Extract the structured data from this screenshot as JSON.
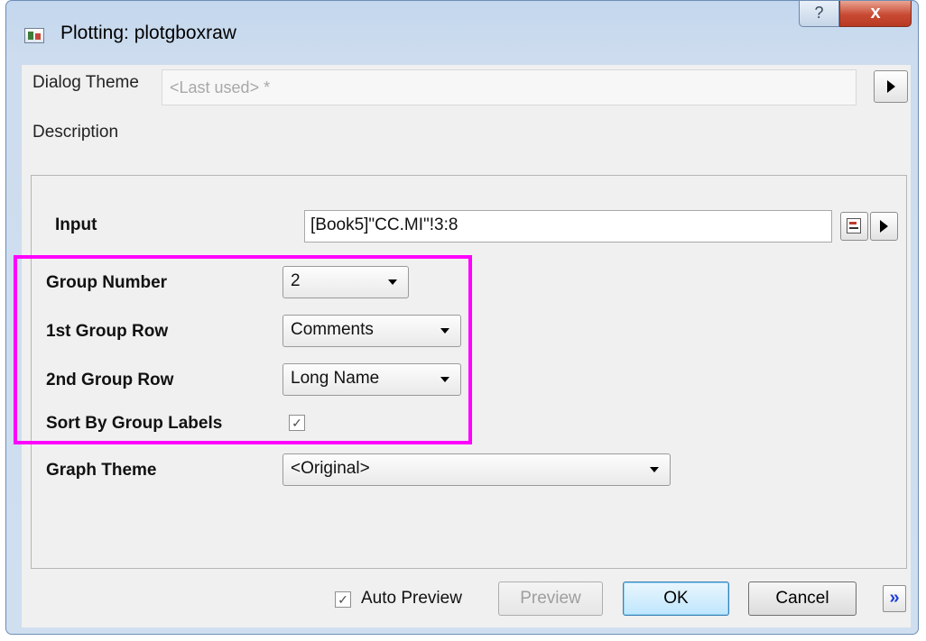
{
  "window": {
    "title": "Plotting: plotgboxraw",
    "help_glyph": "?",
    "close_glyph": "x"
  },
  "header": {
    "theme_label": "Dialog Theme",
    "theme_value": "<Last used> *",
    "description_label": "Description"
  },
  "form": {
    "input_label": "Input",
    "input_value": "[Book5]\"CC.MI\"!3:8",
    "group_number_label": "Group Number",
    "group_number_value": "2",
    "first_group_row_label": "1st Group Row",
    "first_group_row_value": "Comments",
    "second_group_row_label": "2nd Group Row",
    "second_group_row_value": "Long Name",
    "sort_label": "Sort By Group Labels",
    "sort_checked": "✓",
    "graph_theme_label": "Graph Theme",
    "graph_theme_value": "<Original>"
  },
  "footer": {
    "auto_preview_label": "Auto Preview",
    "auto_preview_checked": "✓",
    "preview_label": "Preview",
    "ok_label": "OK",
    "cancel_label": "Cancel",
    "expand_glyph": "»"
  },
  "colors": {
    "highlight": "#ff00ff",
    "close_button": "#c84a33",
    "accent_link": "#1d3fdc"
  }
}
